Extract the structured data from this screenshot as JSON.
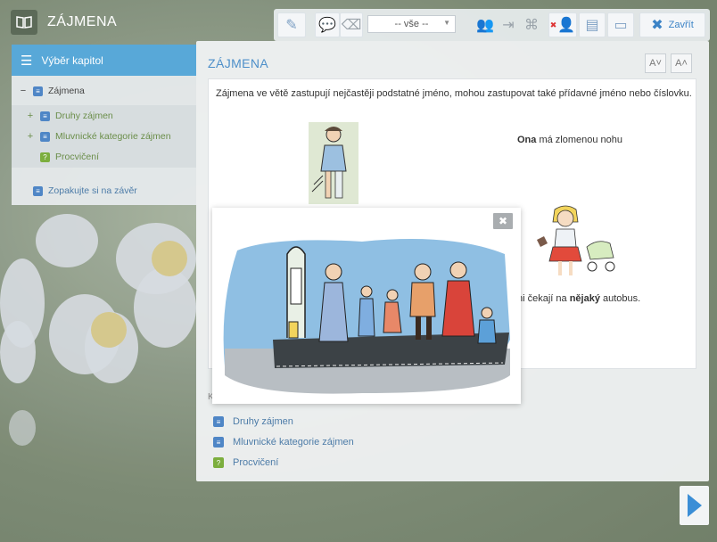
{
  "app": {
    "title": "ZÁJMENA",
    "logo_icon": "open-book-icon"
  },
  "toolbar": {
    "filter_value": "-- vše --",
    "close_label": "Zavřít",
    "icons": [
      "pencil-icon",
      "comments-icon",
      "eraser-icon",
      "users-icon",
      "import-icon",
      "puzzle-icon",
      "user-remove-icon",
      "layout-icon",
      "monitor-icon",
      "close-icon"
    ]
  },
  "sidebar": {
    "header": "Výběr kapitol",
    "items": [
      {
        "prefix": "−",
        "label": "Zájmena"
      },
      {
        "prefix": "+",
        "label": "Druhy zájmen"
      },
      {
        "prefix": "+",
        "label": "Mluvnické kategorie zájmen"
      },
      {
        "prefix": "",
        "label": "Procvičení"
      },
      {
        "prefix": "",
        "label": "Zopakujte si na závěr"
      }
    ]
  },
  "main": {
    "title": "ZÁJMENA",
    "font_smaller": "A˅",
    "font_larger": "A˄",
    "intro": "Zájmena ve větě zastupují nejčastěji podstatné jméno, mohou zastupovat také přídavné jméno nebo číslovku.",
    "sentence1_bold": "Ona",
    "sentence1_rest": " má zlomenou nohu",
    "sentence2_a": "ni čekají na ",
    "sentence2_bold": "nějaký",
    "sentence2_b": " autobus.",
    "partial_letter": "K",
    "list": [
      "Druhy zájmen",
      "Mluvnické kategorie zájmen",
      "Procvičení"
    ]
  },
  "modal": {
    "close_glyph": "✖"
  },
  "colors": {
    "accent": "#58a8d8",
    "blue_text": "#4d8fc9",
    "green": "#7cae3e"
  }
}
